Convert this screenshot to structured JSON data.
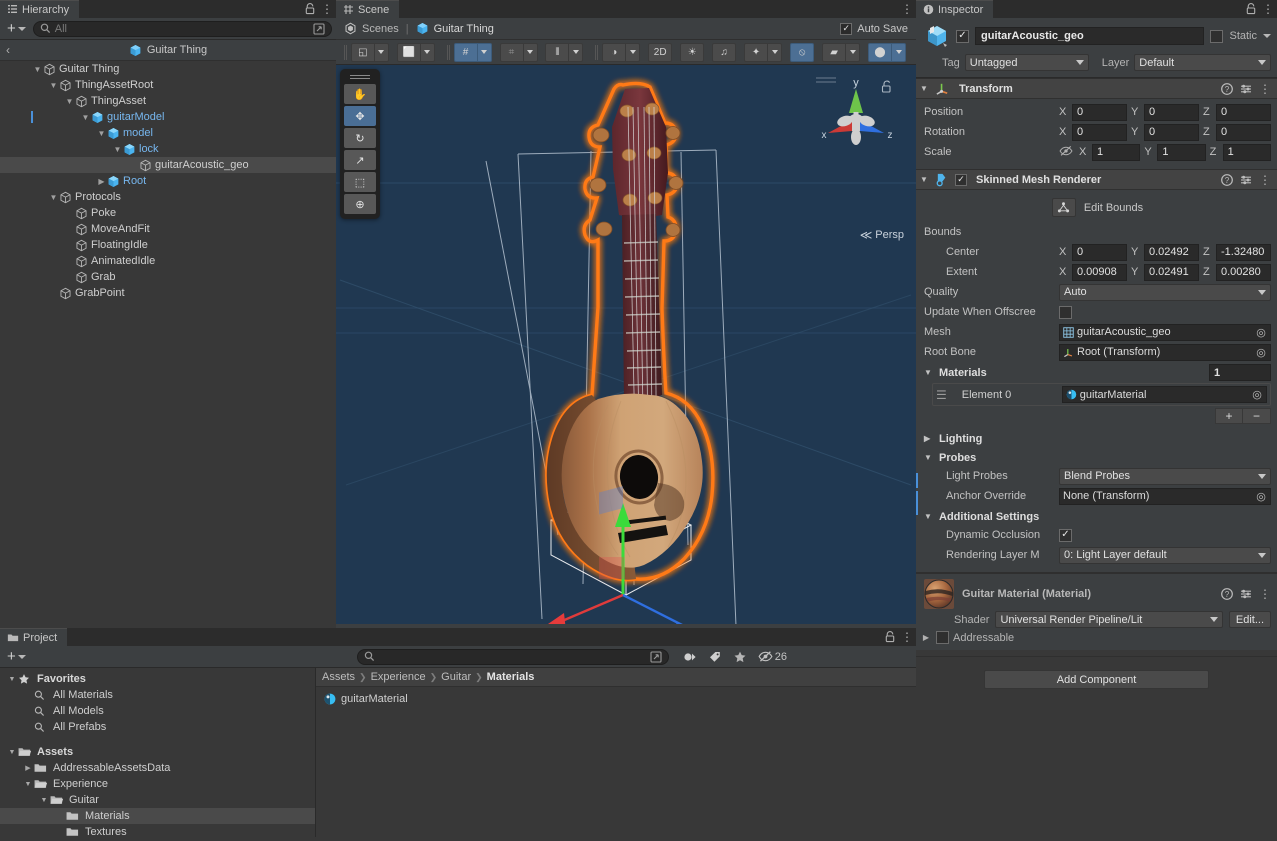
{
  "hierarchy": {
    "tab_label": "Hierarchy",
    "lock_icon": "lock-icon",
    "menu_icon": "kebab-menu-icon",
    "add_label": "+",
    "search_placeholder": "All",
    "breadcrumb": "Guitar Thing",
    "items": [
      {
        "label": "Guitar Thing",
        "depth": 1,
        "tri": "open",
        "prefab": false
      },
      {
        "label": "ThingAssetRoot",
        "depth": 2,
        "tri": "open",
        "prefab": false
      },
      {
        "label": "ThingAsset",
        "depth": 3,
        "tri": "open",
        "prefab": false
      },
      {
        "label": "guitarModel",
        "depth": 4,
        "tri": "open",
        "prefab": true
      },
      {
        "label": "model",
        "depth": 5,
        "tri": "open",
        "prefab": true
      },
      {
        "label": "lock",
        "depth": 6,
        "tri": "open",
        "prefab": true
      },
      {
        "label": "guitarAcoustic_geo",
        "depth": 7,
        "tri": "none",
        "prefab": false,
        "selected": true
      },
      {
        "label": "Root",
        "depth": 5,
        "tri": "closed",
        "prefab": true
      },
      {
        "label": "Protocols",
        "depth": 2,
        "tri": "open",
        "prefab": false
      },
      {
        "label": "Poke",
        "depth": 3,
        "tri": "none",
        "prefab": false
      },
      {
        "label": "MoveAndFit",
        "depth": 3,
        "tri": "none",
        "prefab": false
      },
      {
        "label": "FloatingIdle",
        "depth": 3,
        "tri": "none",
        "prefab": false
      },
      {
        "label": "AnimatedIdle",
        "depth": 3,
        "tri": "none",
        "prefab": false
      },
      {
        "label": "Grab",
        "depth": 3,
        "tri": "none",
        "prefab": false
      },
      {
        "label": "GrabPoint",
        "depth": 2,
        "tri": "none",
        "prefab": false
      }
    ]
  },
  "scene": {
    "tab_label": "Scene",
    "menu_icon": "kebab-menu-icon",
    "scenes_label": "Scenes",
    "scene_name": "Guitar Thing",
    "autosave_label": "Auto Save",
    "autosave_checked": "✓",
    "tools": [
      {
        "name": "hand-tool",
        "glyph": "✋",
        "active": false
      },
      {
        "name": "move-tool",
        "glyph": "✥",
        "active": true
      },
      {
        "name": "rotate-tool",
        "glyph": "↻",
        "active": false
      },
      {
        "name": "scale-tool",
        "glyph": "↗",
        "active": false
      },
      {
        "name": "rect-tool",
        "glyph": "⬚",
        "active": false
      },
      {
        "name": "transform-tool",
        "glyph": "⊕",
        "active": false
      }
    ],
    "toolbar": [
      {
        "name": "pivot-mode",
        "label": "◱",
        "dropdown": true,
        "on": false
      },
      {
        "name": "handle-space",
        "label": "⬜",
        "dropdown": true,
        "on": false
      },
      {
        "name": "grid-visibility",
        "label": "#",
        "dropdown": true,
        "on": true
      },
      {
        "name": "grid-snapping",
        "label": "⌗",
        "dropdown": true,
        "on": false,
        "dim": true
      },
      {
        "name": "snap-increment",
        "label": "⦀",
        "dropdown": true,
        "on": false
      },
      {
        "name": "shading-mode",
        "label": "◑",
        "dropdown": true,
        "on": false
      },
      {
        "name": "2d-toggle",
        "label": "2D",
        "dropdown": false,
        "on": false
      },
      {
        "name": "scene-lighting",
        "label": "☀",
        "dropdown": false,
        "on": false
      },
      {
        "name": "scene-audio",
        "label": "♫",
        "dropdown": false,
        "on": false
      },
      {
        "name": "effects-toggle",
        "label": "✦",
        "dropdown": true,
        "on": false
      },
      {
        "name": "hidden-objects",
        "label": "⦸",
        "dropdown": false,
        "on": true
      },
      {
        "name": "camera-settings",
        "label": "▰",
        "dropdown": true,
        "on": false
      },
      {
        "name": "scene-visibility-globe",
        "label": "⬤",
        "dropdown": true,
        "on": true
      }
    ],
    "gizmo": {
      "axis_y": "y",
      "axis_x": "x",
      "axis_z": "z",
      "perspective_label": "Persp"
    }
  },
  "project": {
    "tab_label": "Project",
    "lock_icon": "lock-icon",
    "menu_icon": "kebab-menu-icon",
    "add_label": "+",
    "search_placeholder": "",
    "filter_icons": [
      "asset-type-filter-icon",
      "label-filter-icon",
      "favorite-filter-icon"
    ],
    "hidden_count": "26",
    "tree": [
      {
        "label": "Favorites",
        "depth": 0,
        "tri": "open",
        "icon": "star-icon",
        "bold": true
      },
      {
        "label": "All Materials",
        "depth": 1,
        "tri": "none",
        "icon": "search-icon"
      },
      {
        "label": "All Models",
        "depth": 1,
        "tri": "none",
        "icon": "search-icon"
      },
      {
        "label": "All Prefabs",
        "depth": 1,
        "tri": "none",
        "icon": "search-icon"
      },
      {
        "label": "",
        "depth": 0,
        "tri": "none",
        "icon": "spacer"
      },
      {
        "label": "Assets",
        "depth": 0,
        "tri": "open",
        "icon": "folder-open-icon",
        "bold": true
      },
      {
        "label": "AddressableAssetsData",
        "depth": 1,
        "tri": "closed",
        "icon": "folder-icon"
      },
      {
        "label": "Experience",
        "depth": 1,
        "tri": "open",
        "icon": "folder-open-icon"
      },
      {
        "label": "Guitar",
        "depth": 2,
        "tri": "open",
        "icon": "folder-open-icon"
      },
      {
        "label": "Materials",
        "depth": 3,
        "tri": "none",
        "icon": "folder-icon",
        "selected": true
      },
      {
        "label": "Textures",
        "depth": 3,
        "tri": "none",
        "icon": "folder-icon"
      }
    ],
    "breadcrumbs": [
      "Assets",
      "Experience",
      "Guitar",
      "Materials"
    ],
    "assets": [
      {
        "label": "guitarMaterial",
        "icon": "material-sphere-icon"
      }
    ]
  },
  "inspector": {
    "tab_label": "Inspector",
    "lock_icon": "lock-icon",
    "menu_icon": "kebab-menu-icon",
    "object_name": "guitarAcoustic_geo",
    "enabled_checked": "✓",
    "static_label": "Static",
    "static_checked": "",
    "tag_label": "Tag",
    "tag_value": "Untagged",
    "layer_label": "Layer",
    "layer_value": "Default",
    "transform": {
      "title": "Transform",
      "rows": [
        {
          "label": "Position",
          "x": "0",
          "y": "0",
          "z": "0"
        },
        {
          "label": "Rotation",
          "x": "0",
          "y": "0",
          "z": "0"
        },
        {
          "label": "Scale",
          "x": "1",
          "y": "1",
          "z": "1",
          "constrain_icon": "constrain-proportions-off-icon"
        }
      ]
    },
    "renderer": {
      "title": "Skinned Mesh Renderer",
      "enabled_checked": "✓",
      "edit_bounds_label": "Edit Bounds",
      "bounds_label": "Bounds",
      "center": {
        "label": "Center",
        "x": "0",
        "y": "0.02492",
        "z": "-1.32480"
      },
      "extent": {
        "label": "Extent",
        "x": "0.00908",
        "y": "0.02491",
        "z": "0.00280"
      },
      "quality_label": "Quality",
      "quality_value": "Auto",
      "update_offscreen_label": "Update When Offscree",
      "update_offscreen_checked": "",
      "mesh_label": "Mesh",
      "mesh_value": "guitarAcoustic_geo",
      "root_bone_label": "Root Bone",
      "root_bone_value": "Root (Transform)",
      "materials_label": "Materials",
      "materials_count": "1",
      "element_label": "Element 0",
      "element_value": "guitarMaterial",
      "add_label": "+",
      "remove_label": "−",
      "lighting_label": "Lighting",
      "probes_label": "Probes",
      "light_probes_label": "Light Probes",
      "light_probes_value": "Blend Probes",
      "anchor_override_label": "Anchor Override",
      "anchor_override_value": "None (Transform)",
      "additional_settings_label": "Additional Settings",
      "dynamic_occlusion_label": "Dynamic Occlusion",
      "dynamic_occlusion_checked": "✓",
      "rendering_layer_label": "Rendering Layer M",
      "rendering_layer_value": "0: Light Layer default"
    },
    "material": {
      "title": "Guitar Material (Material)",
      "shader_label": "Shader",
      "shader_value": "Universal Render Pipeline/Lit",
      "edit_label": "Edit...",
      "addressable_label": "Addressable",
      "addressable_checked": ""
    },
    "add_component_label": "Add Component"
  },
  "colors": {
    "accent_blue": "#4a90d9",
    "selection_orange": "#ff7a14",
    "scene_bg": "#203851",
    "panel_bg": "#383838",
    "header_bg": "#3c3f41"
  }
}
